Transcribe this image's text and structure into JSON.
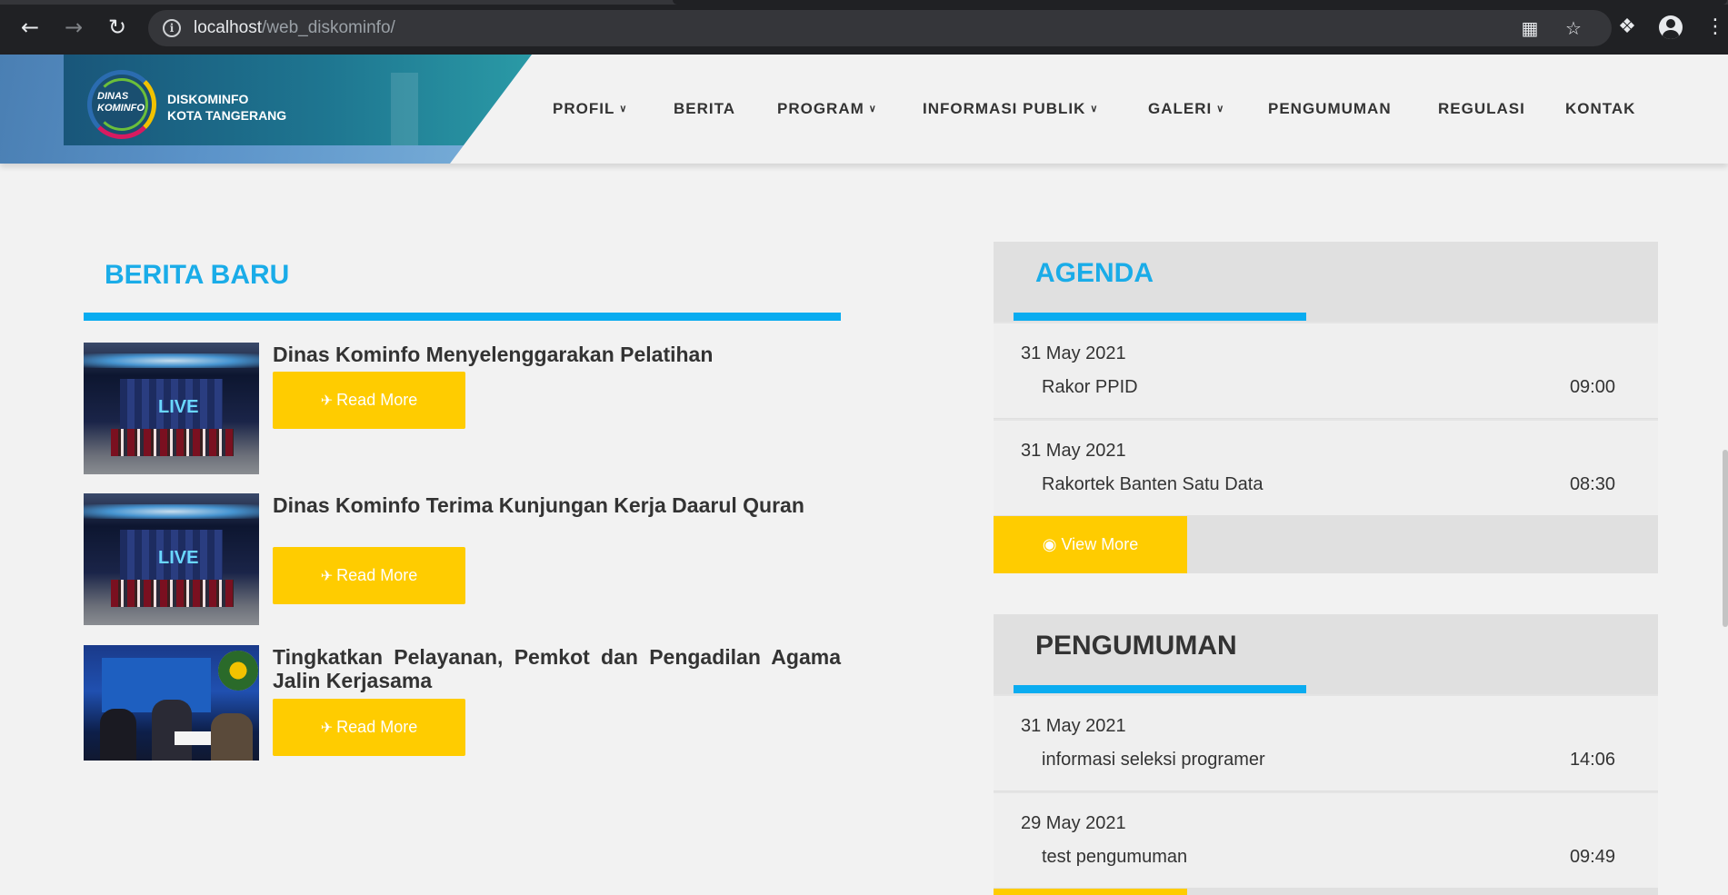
{
  "browser": {
    "back_icon": "arrow-left-icon",
    "forward_icon": "arrow-right-icon",
    "reload_icon": "reload-icon",
    "url_host": "localhost",
    "url_path": "/web_diskominfo/",
    "translate_icon": "translate-icon",
    "bookmark_icon": "star-icon",
    "extensions_icon": "puzzle-icon",
    "profile_icon": "avatar-icon",
    "menu_icon": "kebab-menu-icon"
  },
  "site": {
    "logo_line1": "DISKOMINFO",
    "logo_line2": "KOTA TANGERANG",
    "emblem_line1": "DINAS",
    "emblem_line2": "KOMINFO"
  },
  "nav": [
    {
      "label": "PROFIL",
      "dropdown": true
    },
    {
      "label": "BERITA",
      "dropdown": false
    },
    {
      "label": "PROGRAM",
      "dropdown": true
    },
    {
      "label": "INFORMASI PUBLIK",
      "dropdown": true
    },
    {
      "label": "GALERI",
      "dropdown": true
    },
    {
      "label": "PENGUMUMAN",
      "dropdown": false
    },
    {
      "label": "REGULASI",
      "dropdown": false
    },
    {
      "label": "KONTAK",
      "dropdown": false
    }
  ],
  "berita": {
    "title": "BERITA BARU",
    "read_more_label": "Read More",
    "read_more_icon": "plane-icon",
    "items": [
      {
        "headline": "Dinas Kominfo Menyelenggarakan Pelatihan"
      },
      {
        "headline": "Dinas Kominfo Terima Kunjungan Kerja Daarul Quran"
      },
      {
        "headline": "Tingkatkan Pelayanan, Pemkot dan Pengadilan Agama Jalin Kerjasama"
      }
    ]
  },
  "agenda": {
    "title": "AGENDA",
    "view_more_label": "View More",
    "view_more_icon": "eye-icon",
    "items": [
      {
        "date": "31 May 2021",
        "name": "Rakor PPID",
        "time": "09:00"
      },
      {
        "date": "31 May 2021",
        "name": "Rakortek Banten Satu Data",
        "time": "08:30"
      }
    ]
  },
  "pengumuman": {
    "title": "PENGUMUMAN",
    "items": [
      {
        "date": "31 May 2021",
        "name": "informasi seleksi programer",
        "time": "14:06"
      },
      {
        "date": "29 May 2021",
        "name": "test pengumuman",
        "time": "09:49"
      }
    ]
  },
  "colors": {
    "accent_blue": "#0aacf0",
    "button_yellow": "#ffcc00",
    "agenda_title": "#1aace8",
    "pengumuman_title": "#333333"
  }
}
